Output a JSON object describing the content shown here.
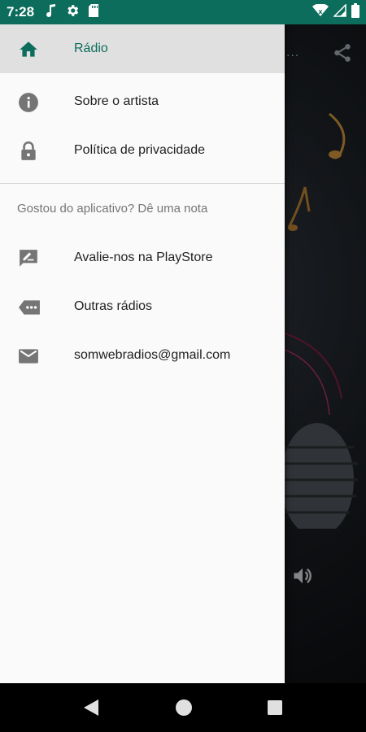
{
  "status_bar": {
    "time": "7:28",
    "left_icons": [
      "music-note-icon",
      "gear-icon",
      "sd-card-icon"
    ],
    "right_icons": [
      "wifi-icon",
      "signal-icon",
      "battery-icon"
    ],
    "background_color": "#0c6d5c"
  },
  "drawer": {
    "primary_items": [
      {
        "label": "Rádio",
        "icon": "home-icon",
        "active": true
      },
      {
        "label": "Sobre o artista",
        "icon": "info-icon",
        "active": false
      },
      {
        "label": "Política de privacidade",
        "icon": "lock-icon",
        "active": false
      }
    ],
    "section_header": "Gostou do aplicativo? Dê uma nota",
    "secondary_items": [
      {
        "label": "Avalie-nos na PlayStore",
        "icon": "rate-review-icon"
      },
      {
        "label": "Outras rádios",
        "icon": "more-label-icon"
      },
      {
        "label": "somwebradios@gmail.com",
        "icon": "email-icon"
      }
    ],
    "accent_color": "#0c6d5c"
  },
  "background_app": {
    "icons": [
      "share-icon",
      "volume-icon"
    ]
  },
  "nav_bar": {
    "buttons": [
      "back-icon",
      "home-circle-icon",
      "recents-icon"
    ]
  }
}
